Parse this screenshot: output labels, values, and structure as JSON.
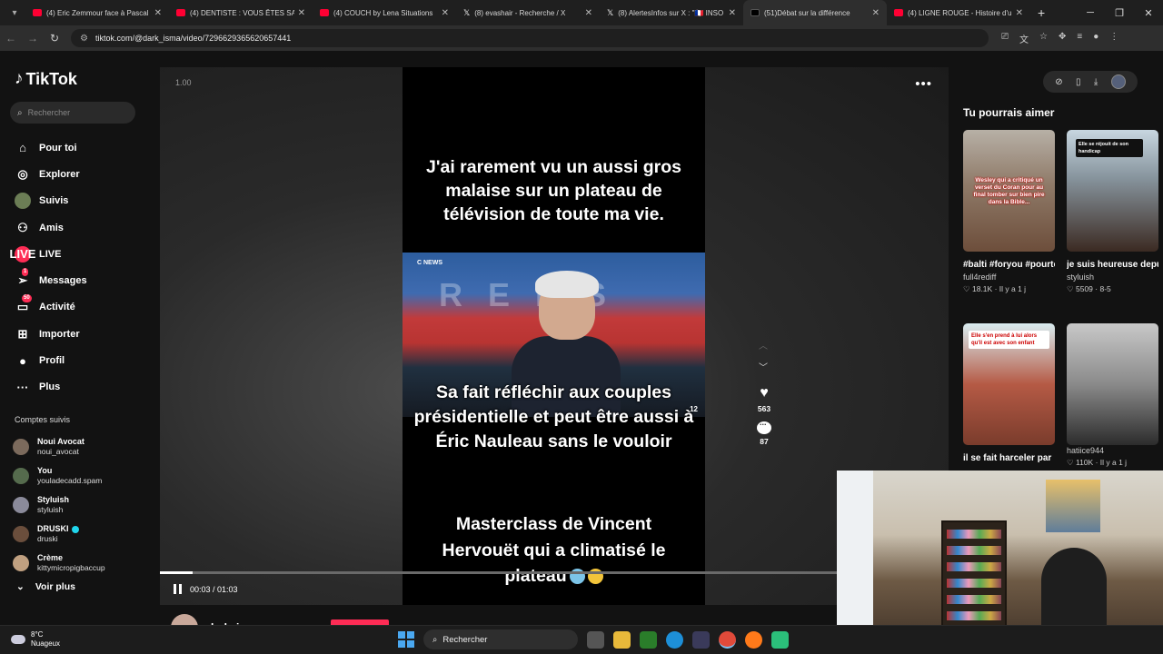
{
  "browser": {
    "tabs": [
      {
        "title": "(4) Eric Zemmour face à Pascal",
        "fav": "yt",
        "active": false
      },
      {
        "title": "(4) DENTISTE : VOUS ÊTES SALE",
        "fav": "yt",
        "active": false
      },
      {
        "title": "(4) COUCH by Lena Situations",
        "fav": "yt",
        "active": false
      },
      {
        "title": "(8) evashair - Recherche / X",
        "fav": "x",
        "active": false
      },
      {
        "title": "(8) AlertesInfos sur X : \"🇫🇷 INSO",
        "fav": "x",
        "active": false
      },
      {
        "title": "(51)Débat sur la différence",
        "fav": "tt",
        "active": true
      },
      {
        "title": "(4) LIGNE ROUGE - Histoire d'u",
        "fav": "yt",
        "active": false
      }
    ],
    "url": "tiktok.com/@dark_isma/video/7296629365620657441"
  },
  "sidebar": {
    "logo": "TikTok",
    "search_placeholder": "Rechercher",
    "nav": [
      {
        "label": "Pour toi",
        "icon": "home-icon",
        "glyph": "⌂"
      },
      {
        "label": "Explorer",
        "icon": "compass-icon",
        "glyph": "◎"
      },
      {
        "label": "Suivis",
        "icon": "following-avatar-icon",
        "glyph": ""
      },
      {
        "label": "Amis",
        "icon": "friends-icon",
        "glyph": "⚇"
      },
      {
        "label": "LIVE",
        "icon": "live-icon",
        "glyph": "LIVE"
      },
      {
        "label": "Messages",
        "icon": "messages-icon",
        "glyph": "➢",
        "badge": "1"
      },
      {
        "label": "Activité",
        "icon": "activity-icon",
        "glyph": "▭",
        "badge": "50"
      },
      {
        "label": "Importer",
        "icon": "upload-icon",
        "glyph": "⊞"
      },
      {
        "label": "Profil",
        "icon": "profile-icon",
        "glyph": "●"
      },
      {
        "label": "Plus",
        "icon": "more-icon",
        "glyph": "···"
      }
    ],
    "followed_heading": "Comptes suivis",
    "followed": [
      {
        "name": "Noui Avocat",
        "handle": "noui_avocat",
        "color": "#7b6a5c",
        "verified": false
      },
      {
        "name": "You",
        "handle": "youladecadd.spam",
        "color": "#556b4d",
        "verified": false
      },
      {
        "name": "Styluish",
        "handle": "styluish",
        "color": "#8a8a9a",
        "verified": false
      },
      {
        "name": "DRUSKI",
        "handle": "druski",
        "color": "#6a4e3c",
        "verified": true
      },
      {
        "name": "Crème",
        "handle": "kittymicropigbaccup",
        "color": "#c0a080",
        "verified": false
      }
    ],
    "see_more": "Voir plus"
  },
  "player": {
    "speed": "1.00",
    "caption_top": "J'ai rarement vu un aussi gros malaise sur un plateau de télévision de toute ma vie.",
    "channel_tag": "C NEWS",
    "frame_number": "12",
    "caption_overlay": "Sa fait réfléchir aux couples présidentielle et peut être aussi à Éric Nauleau sans le vouloir",
    "caption_bottom": "Masterclass de Vincent Hervouët qui a climatisé le plateau",
    "like_count": "563",
    "comment_count": "87",
    "time": "00:03 / 01:03",
    "progress_fraction": 0.048,
    "author": "dark_isma"
  },
  "recommendations": {
    "heading": "Tu pourrais aimer",
    "items": [
      {
        "label": "Wesley qui a critiqué un verset du Coran pour au final tomber sur bien pire dans la Bible...",
        "title": "#balti #foryou #pourtoi",
        "author": "full4rediff",
        "likes": "18.1K",
        "date": "Il y a 1 j"
      },
      {
        "label": "Elle se réjouit de son handicap",
        "title": "je suis heureuse depuis que tu es...",
        "author": "styluish",
        "likes": "5509",
        "date": "8-5"
      },
      {
        "label": "Elle s'en prend à lui alors qu'il est avec son enfant",
        "title": "il se fait harceler par",
        "author": "",
        "likes": "",
        "date": ""
      },
      {
        "label": "",
        "title": "",
        "author": "hatiice944",
        "likes": "110K",
        "date": "Il y a 1 j"
      }
    ]
  },
  "taskbar": {
    "temp": "8°C",
    "weather": "Nuageux",
    "search": "Rechercher"
  }
}
